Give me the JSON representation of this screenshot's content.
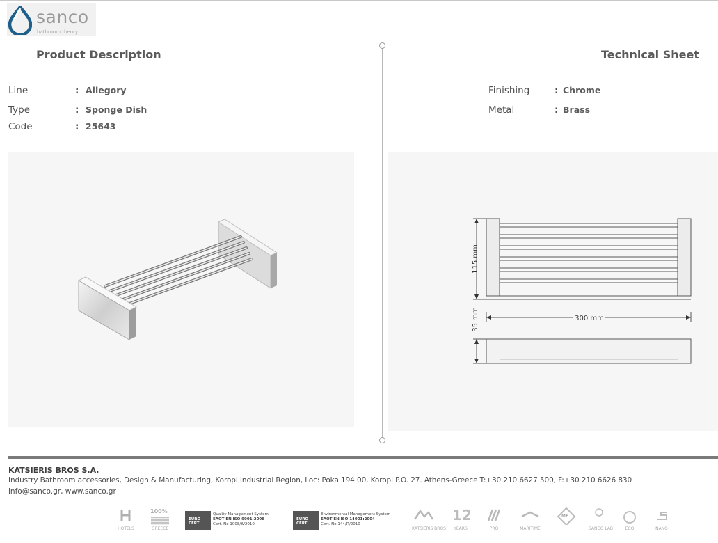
{
  "brand": {
    "name": "sanco",
    "tagline": "bathroom theory"
  },
  "headers": {
    "left": "Product Description",
    "right": "Technical Sheet"
  },
  "specs_left": [
    {
      "label": "Line",
      "value": "Allegory"
    },
    {
      "label": "Type",
      "value": "Sponge Dish"
    },
    {
      "label": "Code",
      "value": "25643"
    }
  ],
  "specs_right": [
    {
      "label": "Finishing",
      "value": "Chrome"
    },
    {
      "label": "Metal",
      "value": "Brass"
    }
  ],
  "separator": ":",
  "dimensions": {
    "height": "115 mm",
    "width": "300 mm",
    "depth": "35 mm"
  },
  "footer": {
    "company": "KATSIERIS BROS S.A.",
    "address": "Industry Bathroom accessories, Design & Manufacturing, Koropi Industrial Region, Loc: Poka 194 00, Koropi P.O. 27. Athens-Greece   T:+30 210 6627 500, F:+30 210 6626 830",
    "contact": "info@sanco.gr, www.sanco.gr"
  },
  "certifications": [
    {
      "seal": "EURO CERT",
      "line1": "Quality Management System",
      "line2": "ΕΛΟΤ EN ISO 9001:2008",
      "line3": "Cert. No 1008/Δ/2010"
    },
    {
      "seal": "EURO CERT",
      "line1": "Environmental Management System",
      "line2": "ΕΛΟΤ EN ISO 14001:2004",
      "line3": "Cert. No 144/Π/2010"
    }
  ],
  "badges": {
    "hotels": "HOTELS",
    "greece_top": "100%",
    "greece_bottom": "GREECE",
    "katsieris": "KATSIERIS BROS",
    "years": "12",
    "years_label": "YEARS",
    "pro": "PRO",
    "maritime": "MARITIME",
    "me": "ME",
    "sanco_lab": "SANCO LAB",
    "eco": "ECO",
    "nano": "NANO"
  },
  "colors": {
    "accent": "#1f5f8b",
    "gray_text": "#4a4a4a",
    "panel": "#f6f6f6"
  }
}
